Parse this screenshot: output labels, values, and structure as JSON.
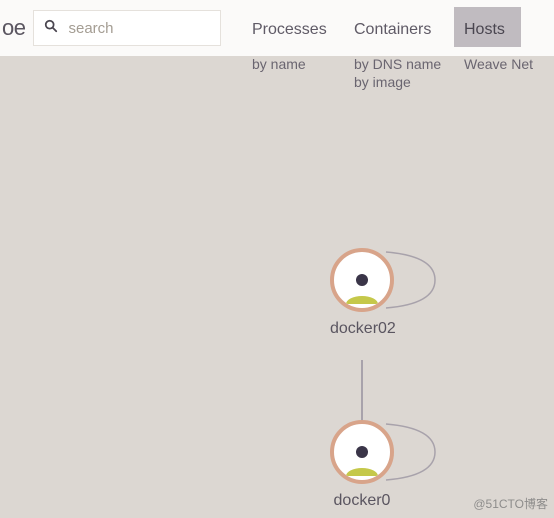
{
  "header": {
    "logo_fragment": "oe",
    "search_placeholder": "search"
  },
  "nav": {
    "processes": {
      "label": "Processes",
      "sub": [
        "by name"
      ]
    },
    "containers": {
      "label": "Containers",
      "sub": [
        "by DNS name",
        "by image"
      ]
    },
    "hosts": {
      "label": "Hosts",
      "sub": [
        "Weave Net"
      ],
      "active": true
    }
  },
  "nodes": [
    {
      "id": "docker02",
      "label": "docker02"
    },
    {
      "id": "docker0x",
      "label": "docker0"
    }
  ],
  "watermark": "@51CTO博客"
}
